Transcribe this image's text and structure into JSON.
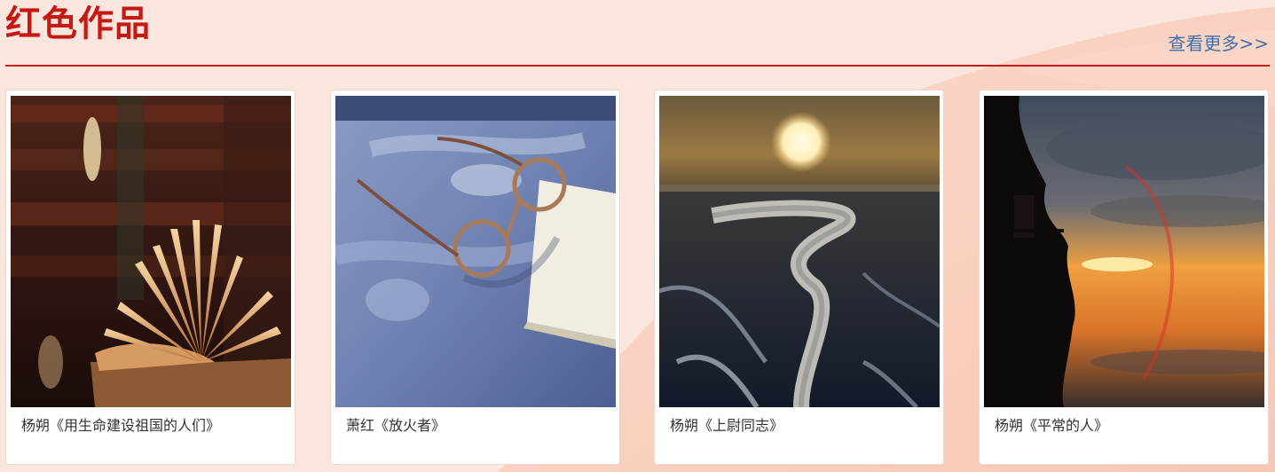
{
  "section": {
    "title": "红色作品",
    "more_link": "查看更多>>"
  },
  "works": [
    {
      "caption": "杨朔《用生命建设祖国的人们》",
      "image": "open-book-on-library-shelves"
    },
    {
      "caption": "萧红《放火者》",
      "image": "eyeglasses-on-book"
    },
    {
      "caption": "杨朔《上尉同志》",
      "image": "sunset-over-river-delta"
    },
    {
      "caption": "杨朔《平常的人》",
      "image": "cliff-pavilion-at-sunset"
    }
  ],
  "colors": {
    "accent_red": "#c41a16",
    "link_blue": "#3f6fa8",
    "page_bg": "#fae6dc"
  }
}
